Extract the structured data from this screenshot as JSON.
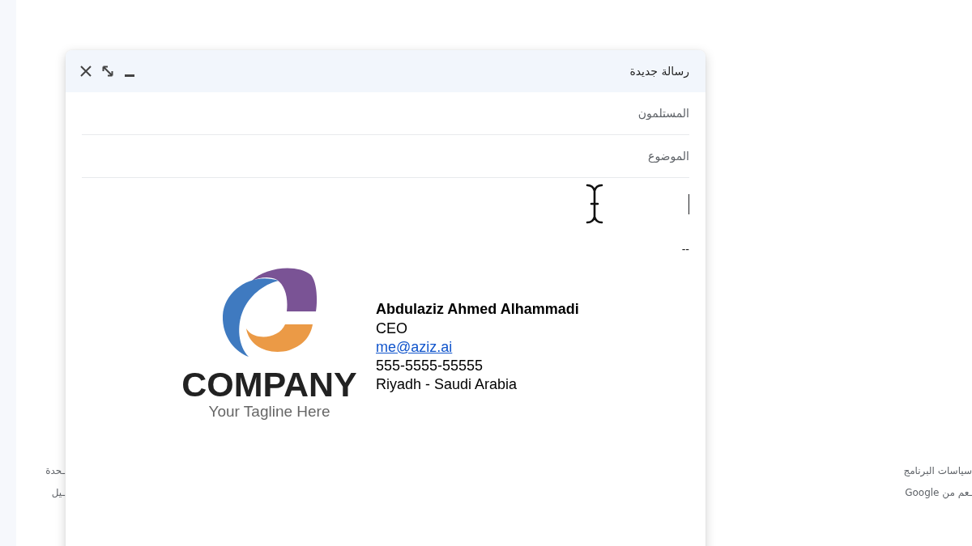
{
  "background": {
    "footer_left": [
      "ـحدة",
      "ـيل"
    ],
    "footer_right": [
      "سياسات البرنامج",
      "ـعم من Google"
    ]
  },
  "compose": {
    "title": "رسالة جديدة",
    "recipients": {
      "placeholder": "المستلمون"
    },
    "subject": {
      "placeholder": "الموضوع"
    },
    "body": {
      "separator": "--",
      "signature": {
        "logo": {
          "wordmark": "COMPANY",
          "tagline": "Your Tagline Here"
        },
        "lines": [
          {
            "kind": "name",
            "text": "Abdulaziz Ahmed Alhammadi"
          },
          {
            "kind": "plain",
            "text": "CEO"
          },
          {
            "kind": "link",
            "text": "me@aziz.ai"
          },
          {
            "kind": "plain",
            "text": "555-5555-55555"
          },
          {
            "kind": "plain",
            "text": "Riyadh - Saudi Arabia"
          }
        ]
      }
    }
  }
}
